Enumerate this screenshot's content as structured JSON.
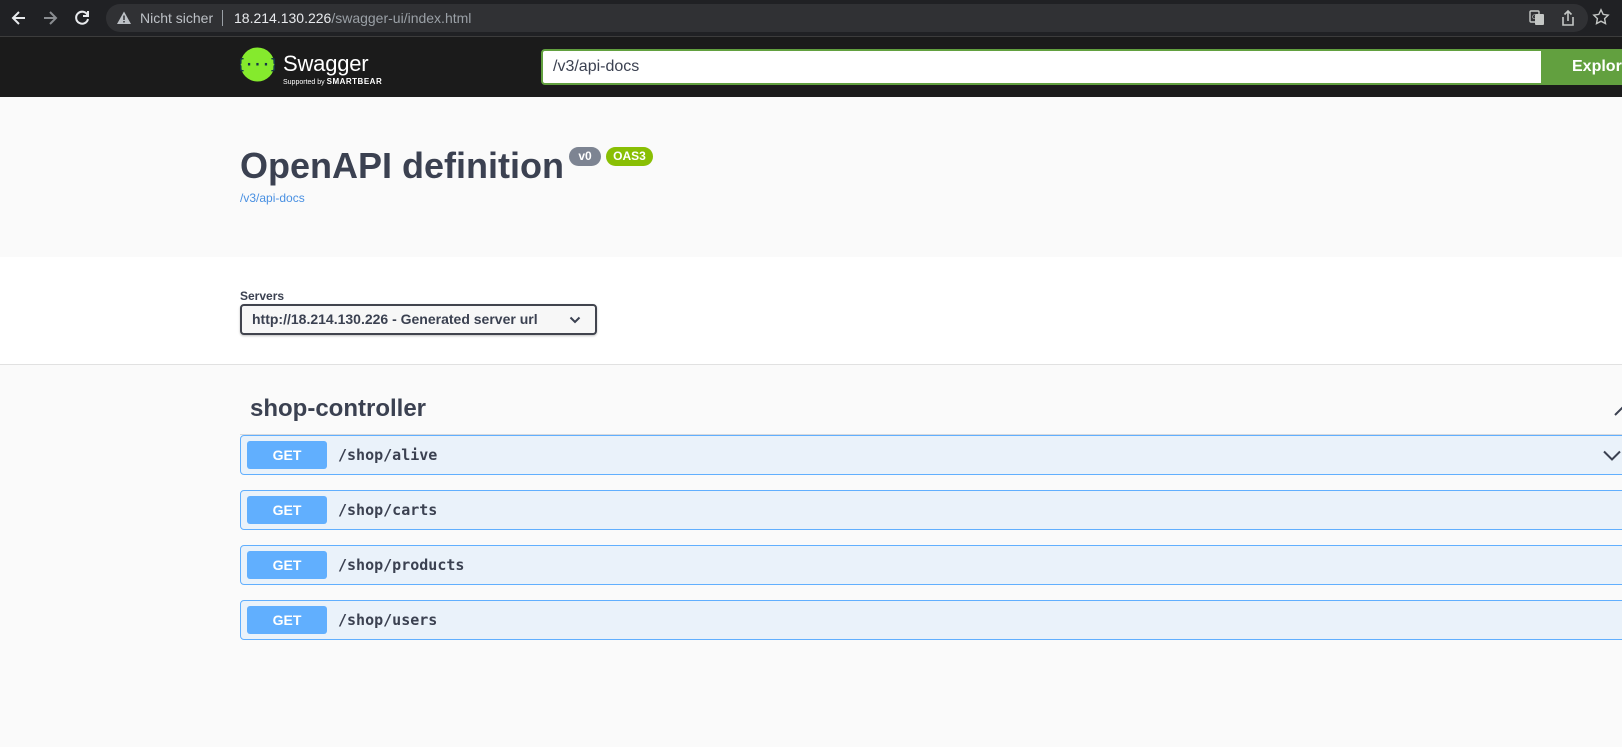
{
  "browser": {
    "security_label": "Nicht sicher",
    "url_host": "18.214.130.226",
    "url_path": "/swagger-ui/index.html"
  },
  "topbar": {
    "logo_text": "Swagger",
    "logo_sub_prefix": "Supported by",
    "logo_sub_brand": "SMARTBEAR",
    "search_value": "/v3/api-docs",
    "explore_label": "Explore"
  },
  "info": {
    "title": "OpenAPI definition",
    "version_badge": "v0",
    "oas_badge": "OAS3",
    "spec_link": "/v3/api-docs"
  },
  "servers": {
    "label": "Servers",
    "selected": "http://18.214.130.226 - Generated server url"
  },
  "tag": {
    "name": "shop-controller",
    "operations": [
      {
        "method": "GET",
        "path": "/shop/alive"
      },
      {
        "method": "GET",
        "path": "/shop/carts"
      },
      {
        "method": "GET",
        "path": "/shop/products"
      },
      {
        "method": "GET",
        "path": "/shop/users"
      }
    ]
  },
  "colors": {
    "get_method": "#61affe",
    "topbar_bg": "#1b1b1b",
    "explore_green": "#62a03f",
    "oas_badge": "#89bf04"
  }
}
